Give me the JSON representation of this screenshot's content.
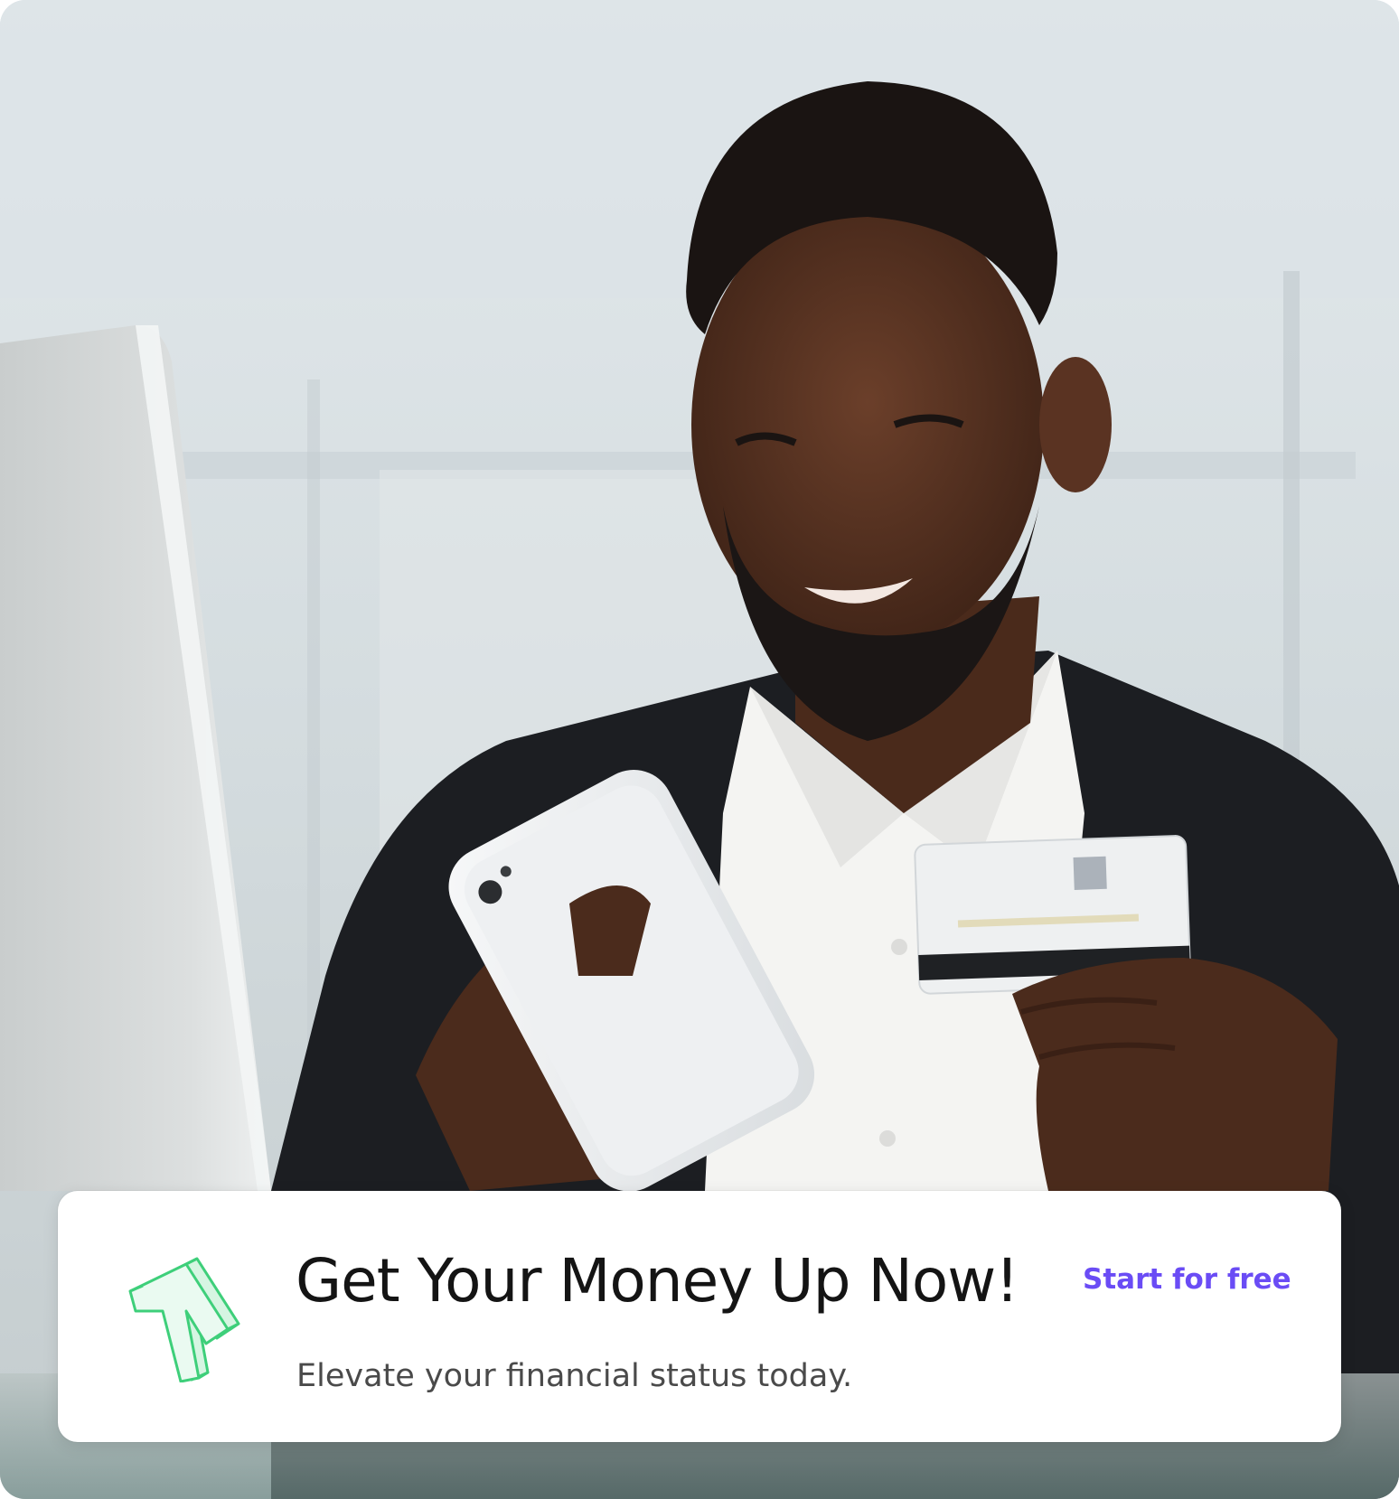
{
  "hero": {
    "image_alt": "Smiling man in a suit holding a smartphone and a credit card"
  },
  "logo": {
    "icon": "up-arrow-logo-icon",
    "color": "#3ecf7a"
  },
  "promo": {
    "headline": "Get Your Money Up Now!",
    "subheadline": "Elevate your financial status today.",
    "cta_label": "Start for free"
  },
  "colors": {
    "accent": "#6a4cf5",
    "logo_green": "#3ecf7a",
    "headline": "#141414",
    "subheadline": "#4a4a4a"
  }
}
